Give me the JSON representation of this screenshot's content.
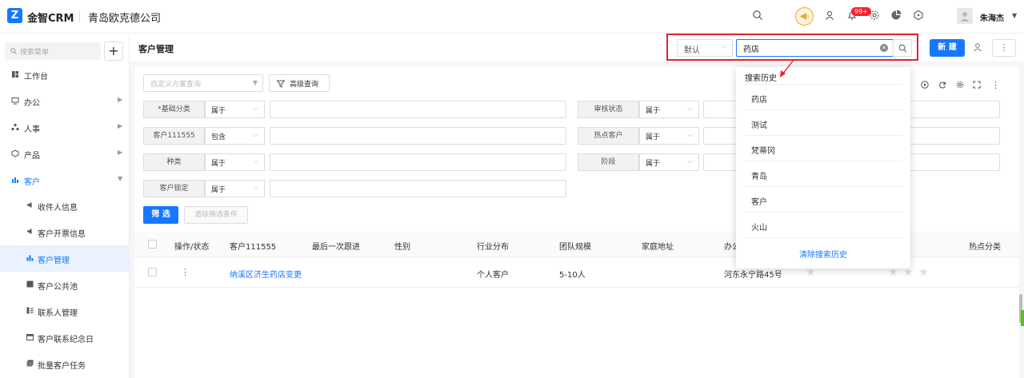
{
  "header": {
    "app_name": "金智CRM",
    "company": "青岛欧克德公司",
    "notif_badge": "99+",
    "user_name": "朱海杰",
    "icons": [
      "search-icon",
      "megaphone-icon",
      "contacts-icon",
      "bell-icon",
      "gear-icon",
      "pie-chart-icon",
      "cube-icon"
    ]
  },
  "sidebar": {
    "search_placeholder": "搜索菜单",
    "add_label": "+",
    "items": [
      {
        "label": "工作台",
        "icon": "dashboard-icon",
        "has_arrow": false
      },
      {
        "label": "办公",
        "icon": "monitor-icon",
        "has_arrow": true
      },
      {
        "label": "人事",
        "icon": "org-icon",
        "has_arrow": true
      },
      {
        "label": "产品",
        "icon": "box-icon",
        "has_arrow": true
      },
      {
        "label": "客户",
        "icon": "customer-icon",
        "has_arrow": true
      }
    ],
    "sub_items": [
      {
        "label": "收件人信息",
        "icon": "megaphone-icon"
      },
      {
        "label": "客户开票信息",
        "icon": "megaphone-icon"
      },
      {
        "label": "客户管理",
        "icon": "customer-icon"
      },
      {
        "label": "客户公共池",
        "icon": "pool-icon"
      },
      {
        "label": "联系人管理",
        "icon": "contact-card-icon"
      },
      {
        "label": "客户联系纪念日",
        "icon": "calendar-icon"
      },
      {
        "label": "批量客户任务",
        "icon": "task-icon"
      }
    ]
  },
  "page": {
    "title": "客户管理",
    "scheme_value": "默认",
    "keyword_value": "药店",
    "new_label": "新 建",
    "more_label": "⋮"
  },
  "filter": {
    "custom_query_placeholder": "自定义方案查询",
    "advanced_label": "高级查询",
    "rows_left": [
      {
        "label": "*基础分类",
        "op": "属于"
      },
      {
        "label": "客户111555",
        "op": "包含"
      },
      {
        "label": "种类",
        "op": "属于"
      },
      {
        "label": "客户锁定",
        "op": "属于"
      }
    ],
    "rows_right": [
      {
        "label": "审核状态",
        "op": "属于"
      },
      {
        "label": "热点客户",
        "op": "属于"
      },
      {
        "label": "阶段",
        "op": "属于"
      }
    ],
    "filter_button": "筛 选",
    "clear_button": "清除筛选条件"
  },
  "table": {
    "columns": [
      "操作/状态",
      "客户111555",
      "最后一次跟进",
      "性别",
      "行业分布",
      "团队规模",
      "家庭地址",
      "办公",
      "热点分类"
    ],
    "rows": [
      {
        "action": "⋮",
        "name": "纳溪区济生药店变更",
        "followup": "",
        "gender": "",
        "industry": "个人客户",
        "team_size": "5-10人",
        "address": "河东永宁路45号"
      }
    ]
  },
  "history": {
    "title": "搜索历史",
    "items": [
      "药店",
      "测试",
      "梵蒂冈",
      "青岛",
      "客户",
      "火山"
    ],
    "clear_label": "清除搜索历史"
  },
  "colors": {
    "primary": "#1677ff",
    "highlight_border": "#e8202a",
    "badge": "#f5222d"
  }
}
